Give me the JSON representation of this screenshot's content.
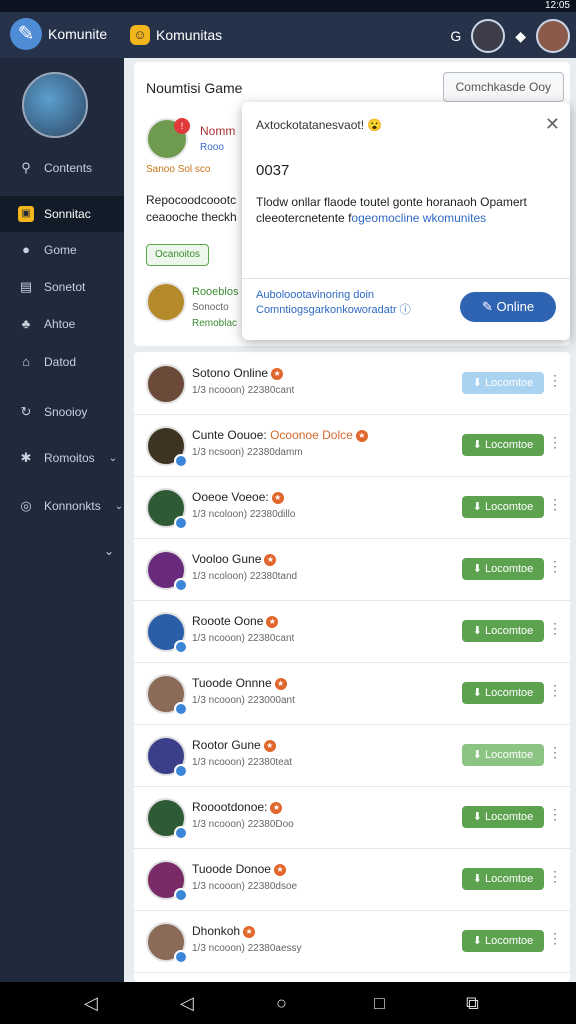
{
  "status": {
    "time": "12:05"
  },
  "topbar": {
    "app_title": "Komunite",
    "logo_icon": "pen-icon",
    "tab_label": "Komunitas",
    "right_letter": "G"
  },
  "sidebar": {
    "items": [
      {
        "label": "Contents",
        "icon": "search-icon",
        "chevron": false
      },
      {
        "label": "Sonnitac",
        "icon": "square-icon",
        "chevron": false
      },
      {
        "label": "Gome",
        "icon": "person-icon",
        "chevron": false
      },
      {
        "label": "Sonetot",
        "icon": "grid-icon",
        "chevron": false
      },
      {
        "label": "Ahtoe",
        "icon": "group-icon",
        "chevron": false
      },
      {
        "label": "Datod",
        "icon": "home-icon",
        "chevron": false
      },
      {
        "label": "Snooioy",
        "icon": "refresh-icon",
        "chevron": false
      },
      {
        "label": "Romoitos",
        "icon": "star-icon",
        "chevron": true
      },
      {
        "label": "Konnonkts",
        "icon": "circle-icon",
        "chevron": true
      }
    ]
  },
  "main": {
    "title": "Noumtisi Game",
    "right_button": "Comchkasde Ooy",
    "featured": {
      "name": "Nomm",
      "subtitle": "Rooo",
      "tags": "Sanoo  Sol sco",
      "desc": "Repocoodcoootc ceaooche theckh",
      "chip": "Ocanoitos",
      "row2": {
        "l1": "Rooeblos",
        "l2": "Sonocto",
        "l3": "Remoblac"
      }
    }
  },
  "popup": {
    "title": "Axtockotatanesvaot!",
    "emoji": "😮",
    "code": "0037",
    "body_prefix": "Tlodw onllar flaode toutel gonte horanaoh Opamert cleeotercnetente f",
    "body_highlight": "ogeomocline wkomunites",
    "footer_line1": "Auboloootavinoring doin",
    "footer_line2": "Comntiogsgarkonkoworadatr",
    "button": "Online"
  },
  "list": [
    {
      "name": "Sotono Online",
      "extra": "",
      "sub": "1/3 ncooon) 22380cant",
      "action": "Locomtoe",
      "state": "light",
      "color": "#6b4a3a"
    },
    {
      "name": "Cunte Oouoe:",
      "extra": "Ocoonoe Dolce",
      "sub": "1/3 ncsoon) 22380damm",
      "action": "Locomtoe",
      "state": "normal",
      "color": "#3d3322"
    },
    {
      "name": "Ooeoe Voeoe:",
      "extra": "",
      "sub": "1/3 ncoloon) 22380dillo",
      "action": "Locomtoe",
      "state": "normal",
      "color": "#2f5a36"
    },
    {
      "name": "Vooloo Gune",
      "extra": "",
      "sub": "1/3 ncoloon) 22380tand",
      "action": "Locomtoe",
      "state": "normal",
      "color": "#6a2a7c"
    },
    {
      "name": "Rooote Oone",
      "extra": "",
      "sub": "1/3 ncooon) 22380cant",
      "action": "Locomtoe",
      "state": "normal",
      "color": "#2a5fa8"
    },
    {
      "name": "Tuoode Onnne",
      "extra": "",
      "sub": "1/3 ncooon) 223000ant",
      "action": "Locomtoe",
      "state": "normal",
      "color": "#8a6b58"
    },
    {
      "name": "Rootor Gune",
      "extra": "",
      "sub": "1/3 ncooon) 22380teat",
      "action": "Locomtoe",
      "state": "fade",
      "color": "#3b3f8a"
    },
    {
      "name": "Rooootdonoe:",
      "extra": "",
      "sub": "1/3 ncooon) 22380Doo",
      "action": "Locomtoe",
      "state": "normal",
      "color": "#2f5a36"
    },
    {
      "name": "Tuoode Donoe",
      "extra": "",
      "sub": "1/3 ncooon) 22380dsoe",
      "action": "Locomtoe",
      "state": "normal",
      "color": "#7a2a66"
    },
    {
      "name": "Dhonkoh",
      "extra": "",
      "sub": "1/3 ncooon) 22380aessy",
      "action": "Locomtoe",
      "state": "normal",
      "color": "#8a6b58"
    }
  ]
}
